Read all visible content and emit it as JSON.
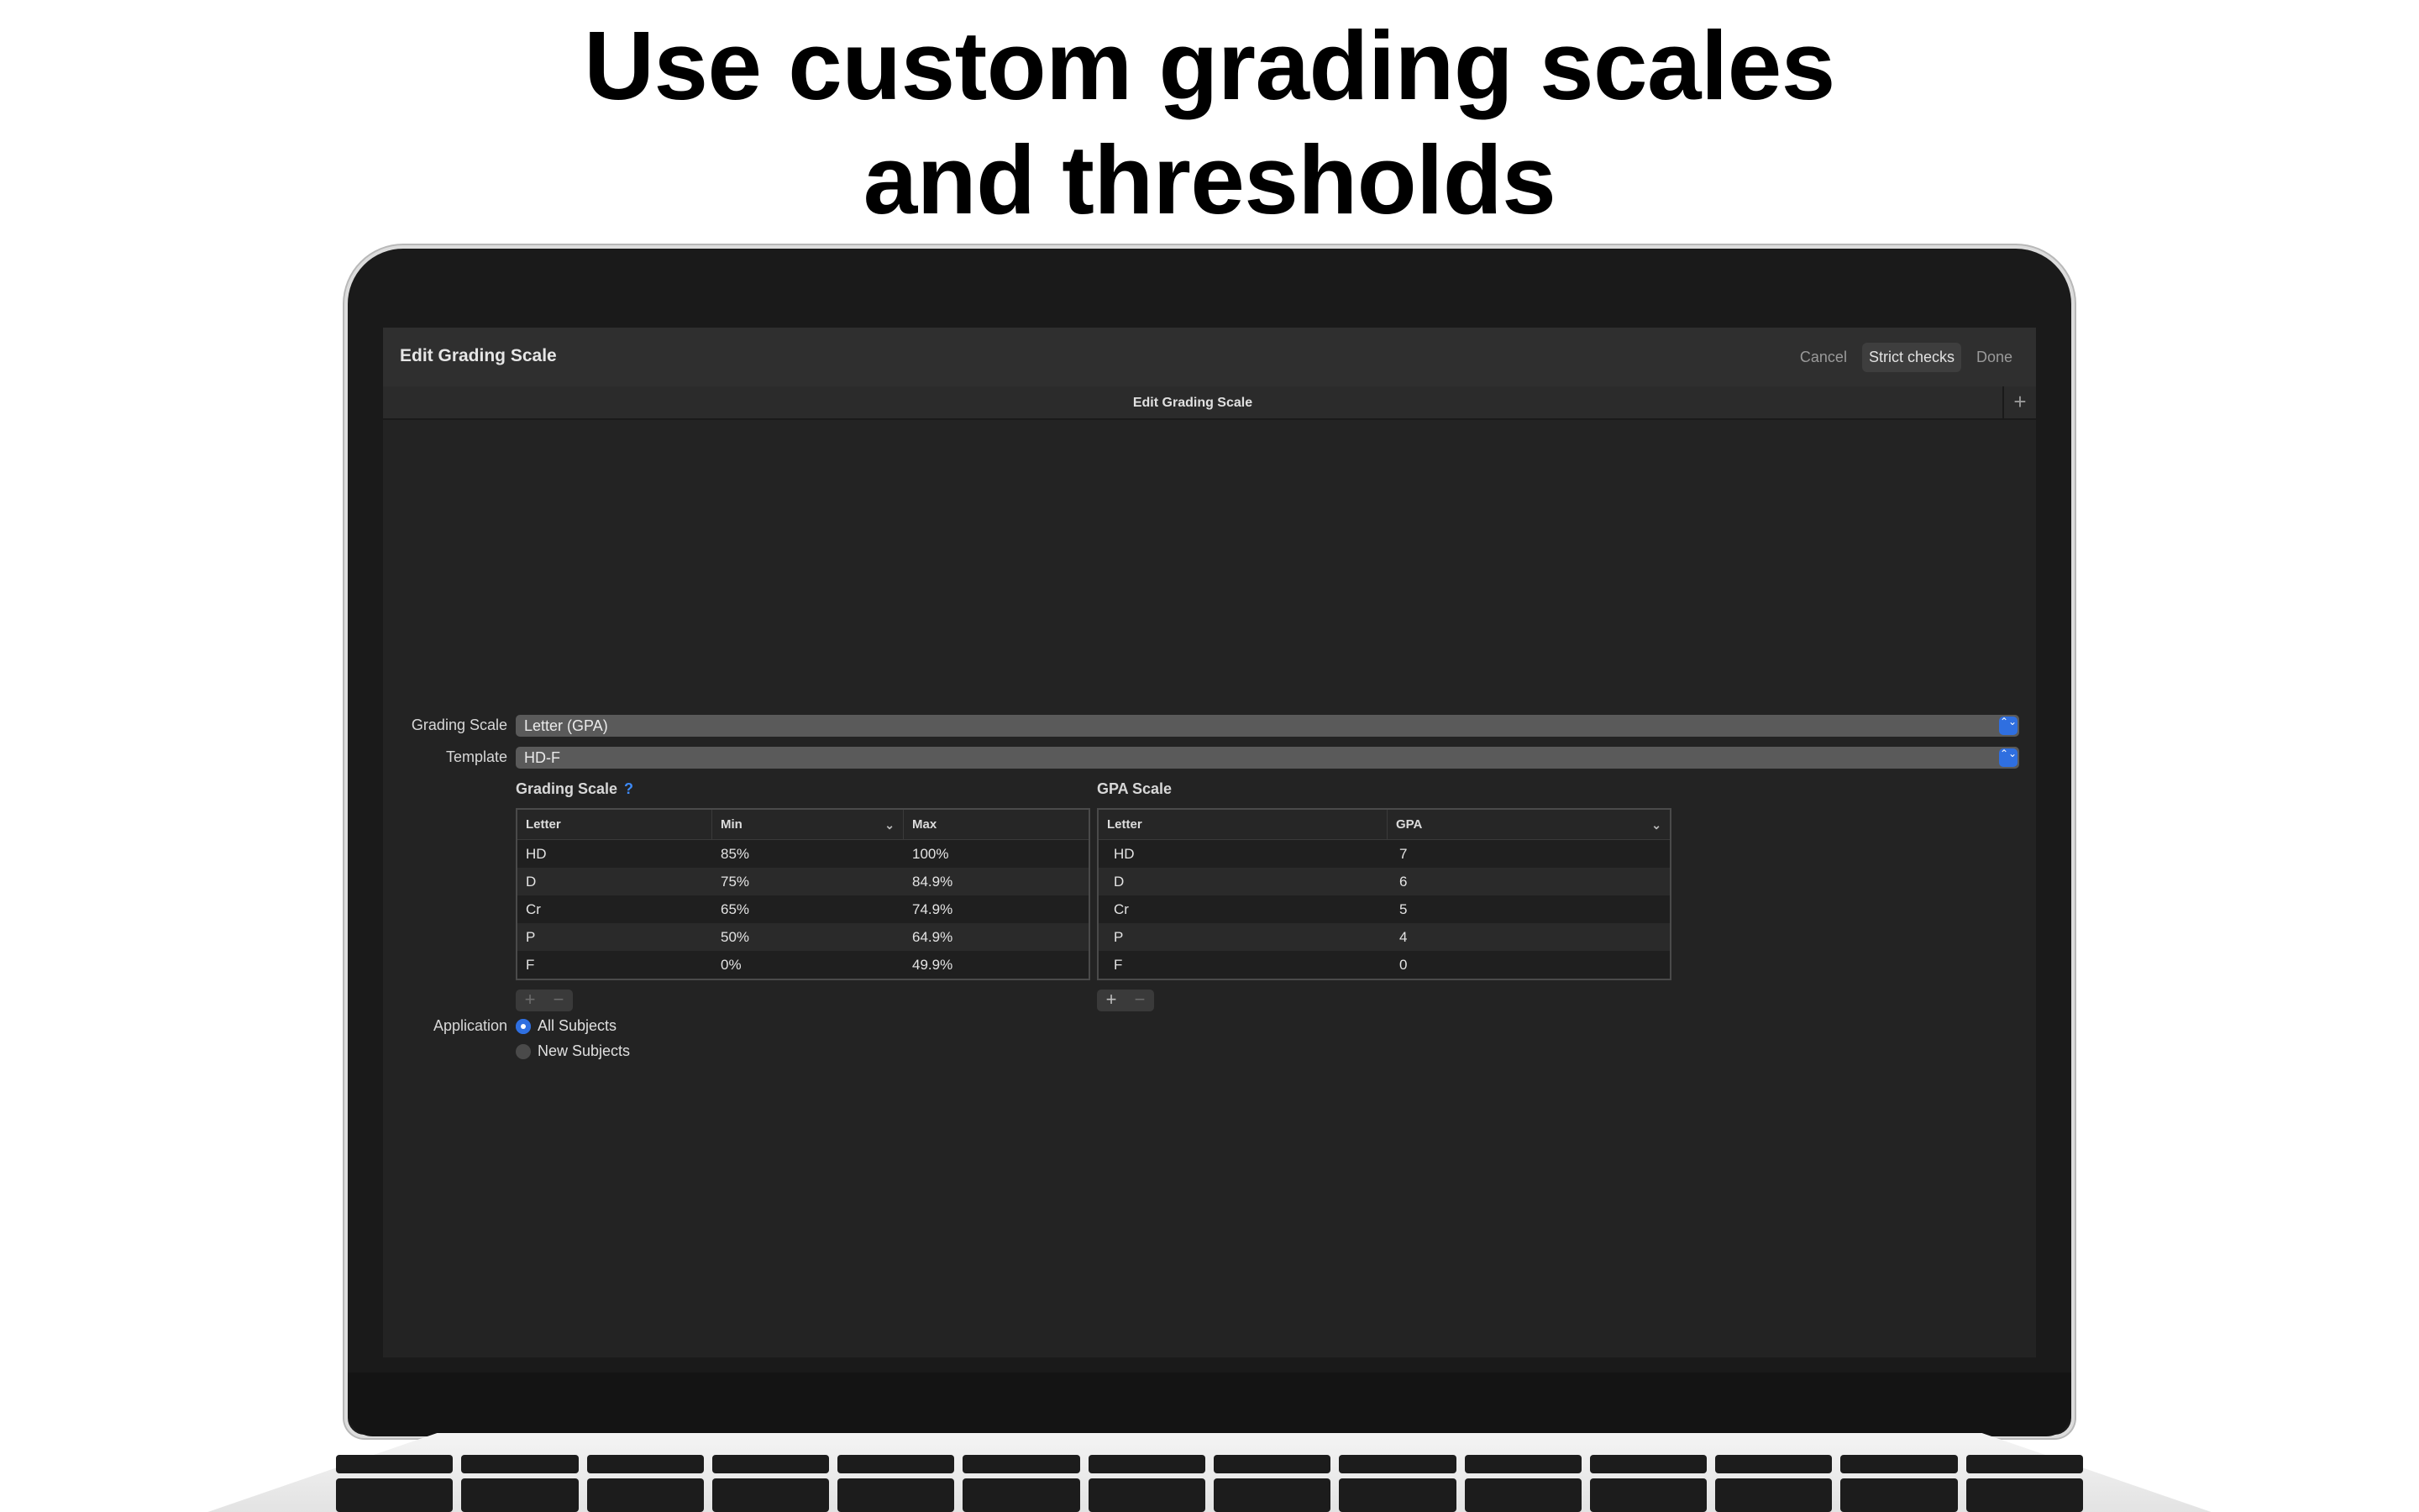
{
  "headline": {
    "line1": "Use custom grading scales",
    "line2": "and thresholds"
  },
  "window": {
    "title": "Edit Grading Scale",
    "buttons": {
      "cancel": "Cancel",
      "strict": "Strict checks",
      "done": "Done"
    },
    "tab": "Edit Grading Scale",
    "tab_add": "+"
  },
  "form": {
    "grading_scale_label": "Grading Scale",
    "grading_scale_value": "Letter (GPA)",
    "template_label": "Template",
    "template_value": "HD-F",
    "application_label": "Application",
    "application_options": [
      "All Subjects",
      "New Subjects"
    ],
    "application_selected": "All Subjects"
  },
  "grading_table": {
    "title": "Grading Scale",
    "help": "?",
    "columns": [
      "Letter",
      "Min",
      "Max"
    ],
    "rows": [
      [
        "HD",
        "85%",
        "100%"
      ],
      [
        "D",
        "75%",
        "84.9%"
      ],
      [
        "Cr",
        "65%",
        "74.9%"
      ],
      [
        "P",
        "50%",
        "64.9%"
      ],
      [
        "F",
        "0%",
        "49.9%"
      ]
    ]
  },
  "gpa_table": {
    "title": "GPA Scale",
    "columns": [
      "Letter",
      "GPA"
    ],
    "rows": [
      [
        "HD",
        "7"
      ],
      [
        "D",
        "6"
      ],
      [
        "Cr",
        "5"
      ],
      [
        "P",
        "4"
      ],
      [
        "F",
        "0"
      ]
    ]
  },
  "controls": {
    "add": "+",
    "remove": "−",
    "caret": "⌄",
    "stepper": "⌃⌄"
  },
  "colors": {
    "accent": "#2f6fe0",
    "help": "#3d8af7",
    "background": "#232323"
  }
}
